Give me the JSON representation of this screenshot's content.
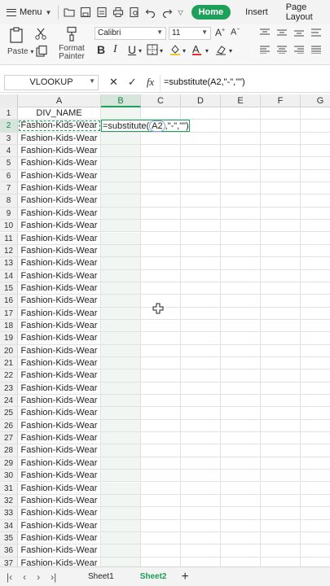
{
  "topbar": {
    "menu_label": "Menu",
    "tabs": [
      "Home",
      "Insert",
      "Page Layout"
    ]
  },
  "ribbon": {
    "paste_label": "Paste",
    "format_painter_label": [
      "Format",
      "Painter"
    ],
    "font_name": "Calibri",
    "font_size": "11"
  },
  "formula_bar": {
    "name_box": "VLOOKUP",
    "formula": "=substitute(A2,\"-\",\"\")",
    "cancel_icon": "✕",
    "enter_icon": "✓",
    "fx_icon": "fx"
  },
  "grid": {
    "columns": [
      "A",
      "B",
      "C",
      "D",
      "E",
      "F",
      "G"
    ],
    "active_column": "B",
    "active_row": 2,
    "header_cell": "DIV_NAME",
    "editing_prefix": "=substitute(",
    "editing_ref": "A2",
    "editing_suffix": ",\"-\",\"\")",
    "row_numbers": [
      "1",
      "2",
      "3",
      "4",
      "5",
      "6",
      "7",
      "8",
      "9",
      "10",
      "11",
      "12",
      "13",
      "14",
      "15",
      "16",
      "17",
      "18",
      "19",
      "20",
      "21",
      "22",
      "23",
      "24",
      "25",
      "26",
      "27",
      "28",
      "29",
      "30",
      "31",
      "32",
      "33",
      "34",
      "35",
      "36",
      "37"
    ],
    "column_a_values": [
      "DIV_NAME",
      "Fashion-Kids-Wear",
      "Fashion-Kids-Wear",
      "Fashion-Kids-Wear",
      "Fashion-Kids-Wear",
      "Fashion-Kids-Wear",
      "Fashion-Kids-Wear",
      "Fashion-Kids-Wear",
      "Fashion-Kids-Wear",
      "Fashion-Kids-Wear",
      "Fashion-Kids-Wear",
      "Fashion-Kids-Wear",
      "Fashion-Kids-Wear",
      "Fashion-Kids-Wear",
      "Fashion-Kids-Wear",
      "Fashion-Kids-Wear",
      "Fashion-Kids-Wear",
      "Fashion-Kids-Wear",
      "Fashion-Kids-Wear",
      "Fashion-Kids-Wear",
      "Fashion-Kids-Wear",
      "Fashion-Kids-Wear",
      "Fashion-Kids-Wear",
      "Fashion-Kids-Wear",
      "Fashion-Kids-Wear",
      "Fashion-Kids-Wear",
      "Fashion-Kids-Wear",
      "Fashion-Kids-Wear",
      "Fashion-Kids-Wear",
      "Fashion-Kids-Wear",
      "Fashion-Kids-Wear",
      "Fashion-Kids-Wear",
      "Fashion-Kids-Wear",
      "Fashion-Kids-Wear",
      "Fashion-Kids-Wear",
      "Fashion-Kids-Wear",
      "Fashion-Kids-Wear"
    ]
  },
  "sheets": {
    "tabs": [
      "Sheet1",
      "Sheet2"
    ],
    "active": "Sheet2",
    "add_icon": "+"
  },
  "colors": {
    "accent": "#1e9f5a"
  }
}
